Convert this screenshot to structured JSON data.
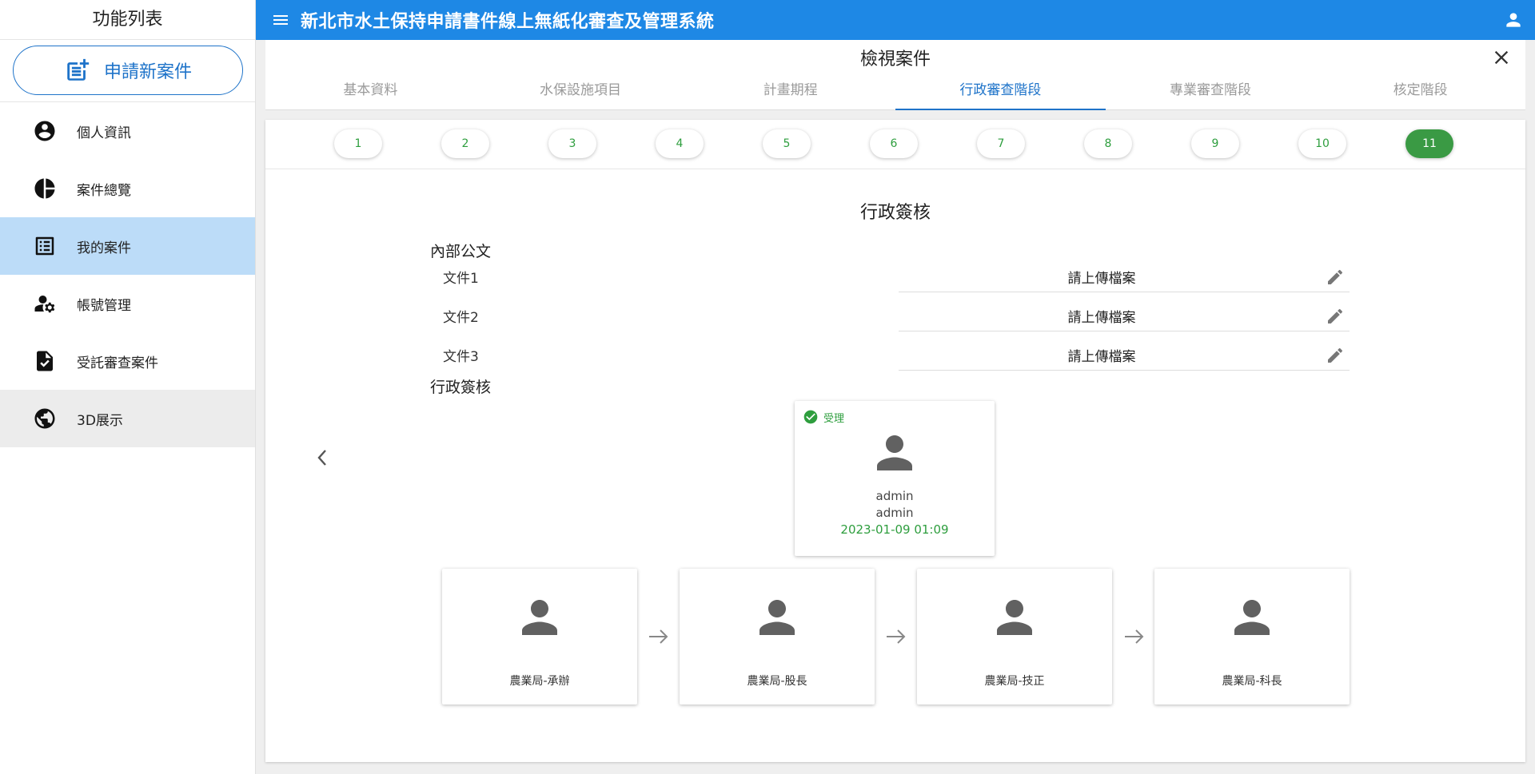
{
  "sidebar": {
    "title": "功能列表",
    "new_case_label": "申請新案件",
    "items": [
      {
        "label": "個人資訊",
        "icon": "account-circle-icon"
      },
      {
        "label": "案件總覽",
        "icon": "pie-chart-icon"
      },
      {
        "label": "我的案件",
        "icon": "list-alt-icon",
        "active": true
      },
      {
        "label": "帳號管理",
        "icon": "manage-accounts-icon"
      },
      {
        "label": "受託審查案件",
        "icon": "file-check-icon"
      },
      {
        "label": "3D展示",
        "icon": "globe-icon"
      }
    ]
  },
  "header": {
    "title": "新北市水土保持申請書件線上無紙化審查及管理系統"
  },
  "view": {
    "title": "檢視案件",
    "tabs": [
      "基本資料",
      "水保設施項目",
      "計畫期程",
      "行政審查階段",
      "專業審查階段",
      "核定階段"
    ],
    "active_tab": "行政審查階段",
    "steps": [
      "1",
      "2",
      "3",
      "4",
      "5",
      "6",
      "7",
      "8",
      "9",
      "10",
      "11"
    ],
    "active_step": "11"
  },
  "section": {
    "title": "行政簽核",
    "internal_docs_title": "內部公文",
    "docs": [
      {
        "label": "文件1",
        "value": "請上傳檔案"
      },
      {
        "label": "文件2",
        "value": "請上傳檔案"
      },
      {
        "label": "文件3",
        "value": "請上傳檔案"
      }
    ],
    "approval_title": "行政簽核",
    "approval_card": {
      "status": "受理",
      "name": "admin",
      "account": "admin",
      "time": "2023-01-09 01:09"
    },
    "flow": [
      {
        "label": "農業局-承辦"
      },
      {
        "label": "農業局-股長"
      },
      {
        "label": "農業局-技正"
      },
      {
        "label": "農業局-科長"
      }
    ]
  },
  "colors": {
    "primary": "#1e88e5",
    "active_nav": "#bcdcf8",
    "success": "#2e9e3e"
  }
}
